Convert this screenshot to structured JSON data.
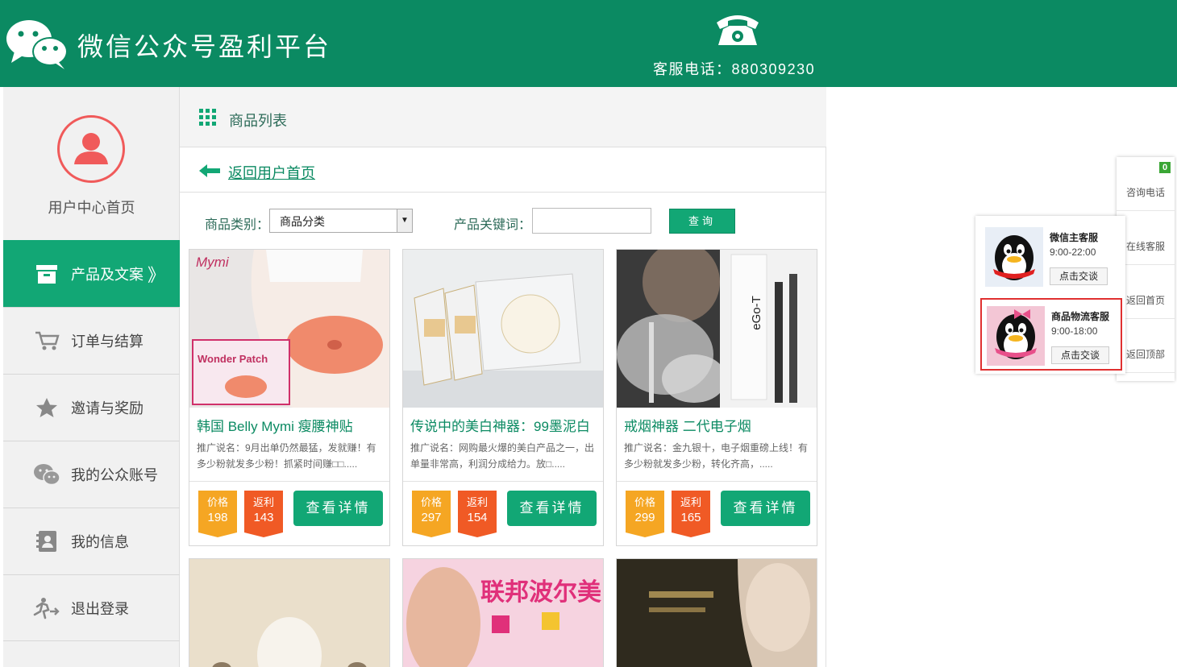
{
  "header": {
    "brand": "微信公众号盈利平台",
    "hotline": "客服电话：880309230"
  },
  "sidebar": {
    "user_home": "用户中心首页",
    "items": [
      {
        "label": "产品及文案",
        "icon": "archive-icon",
        "active": true,
        "chevron": "》"
      },
      {
        "label": "订单与结算",
        "icon": "cart-icon"
      },
      {
        "label": "邀请与奖励",
        "icon": "star-icon"
      },
      {
        "label": "我的公众账号",
        "icon": "wechat-icon"
      },
      {
        "label": "我的信息",
        "icon": "contact-card-icon"
      },
      {
        "label": "退出登录",
        "icon": "runner-exit-icon"
      }
    ]
  },
  "main": {
    "title": "商品列表",
    "back_link": "返回用户首页",
    "filter": {
      "category_label": "商品类别：",
      "category_value": "商品分类",
      "keyword_label": "产品关键词：",
      "keyword_value": "",
      "query_button": "查询"
    },
    "products": [
      {
        "name": "韩国 Belly Mymi 瘦腰神贴",
        "desc": "推广说名：9月出单仍然最猛，发就赚！有多少粉就发多少粉！抓紧时间赚□□.....",
        "price_label": "价格",
        "price": "198",
        "rebate_label": "返利",
        "rebate": "143",
        "button": "查看详情",
        "image_text": "Mymi"
      },
      {
        "name": "传说中的美白神器：99墨泥白",
        "desc": "推广说名：网购最火爆的美白产品之一，出单量非常高，利润分成给力。放□.....",
        "price_label": "价格",
        "price": "297",
        "rebate_label": "返利",
        "rebate": "154",
        "button": "查看详情",
        "image_text": ""
      },
      {
        "name": "戒烟神器 二代电子烟",
        "desc": "推广说名：金九银十，电子烟重磅上线！有多少粉就发多少粉，转化齐高，.....",
        "price_label": "价格",
        "price": "299",
        "rebate_label": "返利",
        "rebate": "165",
        "button": "查看详情",
        "image_text": "eGo-T"
      }
    ],
    "second_row_banner": "联邦波尔美"
  },
  "float_bar": {
    "badge": "0",
    "items": [
      "咨询电话",
      "在线客服",
      "返回首页",
      "返回顶部"
    ]
  },
  "customer_service": [
    {
      "name": "微信主客服",
      "hours": "9:00-22:00",
      "button": "点击交谈"
    },
    {
      "name": "商品物流客服",
      "hours": "9:00-18:00",
      "button": "点击交谈"
    }
  ],
  "colors": {
    "brand_green": "#0b8a62",
    "accent_green": "#12a775",
    "price_orange": "#f5a623",
    "rebate_orange": "#f05a25"
  }
}
